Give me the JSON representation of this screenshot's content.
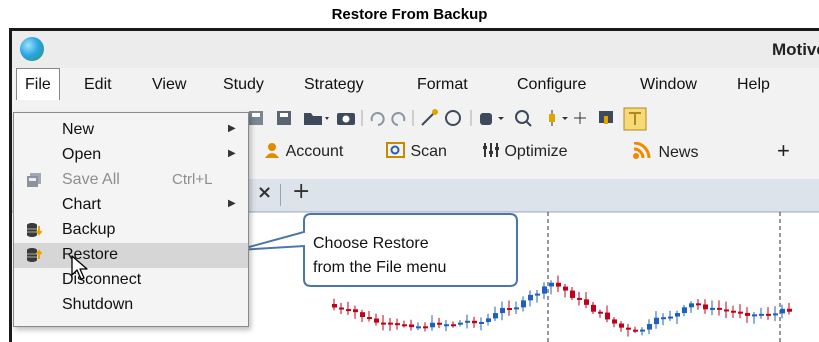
{
  "caption": "Restore From Backup",
  "window": {
    "title": "Motive"
  },
  "menubar": [
    "File",
    "Edit",
    "View",
    "Study",
    "Strategy",
    "Format",
    "Configure",
    "Window",
    "Help"
  ],
  "toolbar2": {
    "account": "Account",
    "scan": "Scan",
    "optimize": "Optimize",
    "news": "News",
    "add": "+"
  },
  "tabs": {
    "close": "×",
    "add": "+"
  },
  "file_menu": {
    "items": [
      {
        "label": "New",
        "has_submenu": true,
        "icon": "none"
      },
      {
        "label": "Open",
        "has_submenu": true,
        "icon": "none"
      },
      {
        "label": "Save All",
        "shortcut": "Ctrl+L",
        "disabled": true,
        "icon": "save-all-icon"
      },
      {
        "label": "Chart",
        "has_submenu": true,
        "icon": "none"
      },
      {
        "label": "Backup",
        "icon": "backup-icon"
      },
      {
        "label": "Restore",
        "icon": "restore-icon",
        "highlighted": true
      },
      {
        "label": "Disconnect",
        "icon": "none"
      },
      {
        "label": "Shutdown",
        "icon": "none"
      }
    ]
  },
  "callout": {
    "line1": "Choose Restore",
    "line2": "from the File menu"
  },
  "colors": {
    "bull": "#1f5fbf",
    "bear": "#c0001a",
    "highlight": "#d6d6d6",
    "tabbar": "#dde3ea"
  }
}
